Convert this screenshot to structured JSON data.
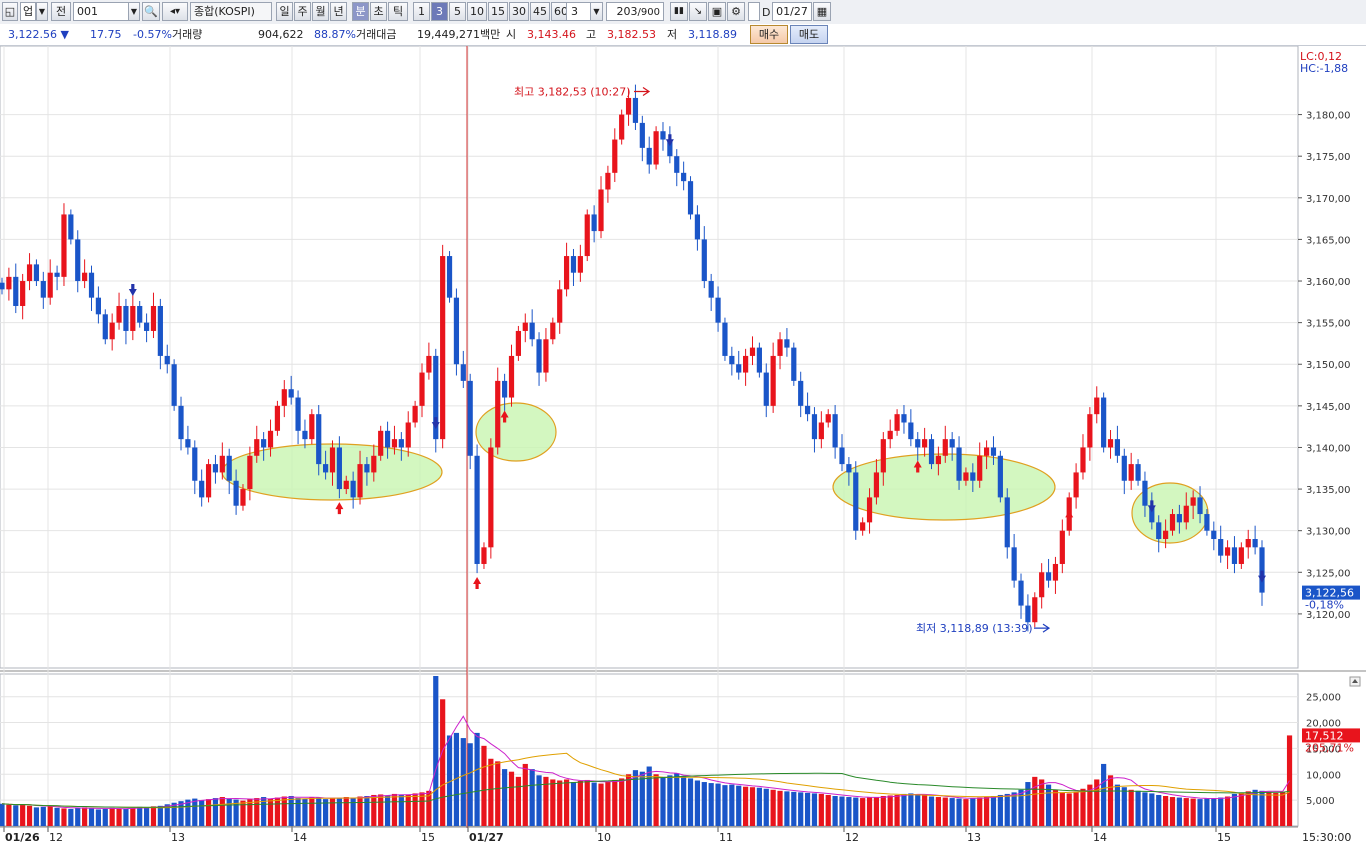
{
  "toolbar": {
    "market_label": "업",
    "prev_label": "전",
    "code_value": "001",
    "index_name": "종합(KOSPI)",
    "period_buttons": [
      "일",
      "주",
      "월",
      "년",
      "분",
      "초",
      "틱"
    ],
    "interval_buttons": [
      "1",
      "3",
      "5",
      "10",
      "15",
      "30",
      "45",
      "60"
    ],
    "interval_input": "3",
    "count_value": "203",
    "count_total": "/900",
    "date_value": "01/27",
    "d_label": "D"
  },
  "quote": {
    "price": "3,122.56",
    "change": "17.75",
    "change_pct": "-0.57%",
    "volume_label": "거래량",
    "volume": "904,622",
    "volume_ratio": "88.87%",
    "amount_label": "거래대금",
    "amount": "19,449,271",
    "amount_unit": "백만",
    "open_label": "시",
    "open": "3,143.46",
    "high_label": "고",
    "high": "3,182.53",
    "low_label": "저",
    "low": "3,118.89",
    "buy_label": "매수",
    "sell_label": "매도"
  },
  "chart_data": {
    "type": "candlestick",
    "y_ticks": [
      "3,180,00",
      "3,175,00",
      "3,170,00",
      "3,165,00",
      "3,160,00",
      "3,155,00",
      "3,150,00",
      "3,145,00",
      "3,140,00",
      "3,135,00",
      "3,130,00",
      "3,125,00",
      "3,120,00"
    ],
    "y_values": [
      3180,
      3175,
      3170,
      3165,
      3160,
      3155,
      3150,
      3145,
      3140,
      3135,
      3130,
      3125,
      3120
    ],
    "ylim": [
      3113.5,
      3188
    ],
    "price_label": "3,122,56",
    "price_label_value": 3122.56,
    "price_change_label": "-0,18%",
    "lc_label": "LC:0,12",
    "hc_label": "HC:-1,88",
    "high_annotation": "최고 3,182,53 (10:27)",
    "high_value": 3182.53,
    "low_annotation": "최저 3,118,89 (13:39)",
    "low_value": 3118.89,
    "x_labels": [
      "01/26",
      "12",
      "13",
      "14",
      "15",
      "01/27",
      "10",
      "11",
      "12",
      "13",
      "14",
      "15"
    ],
    "time_label": "15:30:00",
    "volume_ticks": [
      "25,000",
      "20,000",
      "15,000",
      "10,000",
      "5,000"
    ],
    "volume_tick_values": [
      25000,
      20000,
      15000,
      10000,
      5000
    ],
    "volume_ylim": [
      0,
      29000
    ],
    "volume_label": "17,512",
    "volume_label_value": 17512,
    "volume_ratio_label": "205,71%",
    "colors": {
      "up": "#e8141c",
      "down": "#1a55c8",
      "ellipse_fill": "#c8f5b0",
      "ellipse_stroke": "#e0a020"
    },
    "price_path": [
      3159,
      3160.5,
      3157,
      3160,
      3162,
      3160,
      3158,
      3161,
      3160.5,
      3168,
      3165,
      3160,
      3161,
      3158,
      3156,
      3153,
      3155,
      3157,
      3154,
      3157,
      3155,
      3154,
      3157,
      3151,
      3150,
      3145,
      3141,
      3140,
      3136,
      3134,
      3138,
      3137,
      3139,
      3136,
      3133,
      3135,
      3139,
      3141,
      3140,
      3142,
      3145,
      3147,
      3146,
      3142,
      3141,
      3144,
      3138,
      3137,
      3140,
      3135,
      3136,
      3134,
      3138,
      3137,
      3139,
      3142,
      3140,
      3141,
      3140,
      3143,
      3145,
      3149,
      3151,
      3141,
      3163,
      3158,
      3150,
      3148,
      3139,
      3126,
      3128,
      3140,
      3148,
      3146,
      3151,
      3154,
      3155,
      3153,
      3149,
      3153,
      3155,
      3159,
      3163,
      3161,
      3163,
      3168,
      3166,
      3171,
      3173,
      3177,
      3180,
      3182,
      3179,
      3176,
      3174,
      3178,
      3177,
      3175,
      3173,
      3172,
      3168,
      3165,
      3160,
      3158,
      3155,
      3151,
      3150,
      3149,
      3151,
      3152,
      3149,
      3145,
      3151,
      3153,
      3152,
      3148,
      3145,
      3144,
      3141,
      3143,
      3144,
      3140,
      3138,
      3137,
      3130,
      3131,
      3134,
      3137,
      3141,
      3142,
      3144,
      3143,
      3141,
      3140,
      3141,
      3138,
      3139,
      3141,
      3140,
      3136,
      3137,
      3136,
      3139,
      3140,
      3139,
      3134,
      3128,
      3124,
      3121,
      3119,
      3122,
      3125,
      3124,
      3126,
      3130,
      3134,
      3137,
      3140,
      3144,
      3146,
      3140,
      3141,
      3139,
      3136,
      3138,
      3136,
      3133,
      3131,
      3129,
      3130,
      3132,
      3131,
      3133,
      3134,
      3132,
      3130,
      3129,
      3127,
      3128,
      3126,
      3128,
      3129,
      3128,
      3122.56
    ],
    "volumes": [
      4300,
      4100,
      4000,
      4200,
      3900,
      3600,
      3700,
      3800,
      3500,
      3400,
      3300,
      3500,
      3600,
      3400,
      3200,
      3300,
      3500,
      3400,
      3300,
      3500,
      3700,
      3600,
      3800,
      3900,
      4200,
      4500,
      4800,
      5100,
      5300,
      5000,
      5200,
      5400,
      5600,
      5300,
      5100,
      4900,
      5200,
      5400,
      5600,
      5300,
      5500,
      5700,
      5800,
      5400,
      5300,
      5600,
      5500,
      5200,
      5400,
      5300,
      5600,
      5500,
      5700,
      5800,
      6000,
      6100,
      5900,
      6200,
      6000,
      6100,
      6300,
      6500,
      6800,
      29000,
      24500,
      17500,
      18000,
      17000,
      16000,
      18000,
      15500,
      13000,
      12500,
      11000,
      10500,
      9500,
      12000,
      11000,
      9800,
      9500,
      9000,
      8800,
      9000,
      8500,
      8700,
      8900,
      8400,
      8200,
      8600,
      8900,
      9200,
      10000,
      10800,
      10500,
      11500,
      10000,
      9500,
      9800,
      10200,
      9700,
      9200,
      8800,
      8500,
      8300,
      8200,
      7900,
      8000,
      7800,
      7600,
      7500,
      7400,
      7200,
      7000,
      6800,
      6700,
      6600,
      6500,
      6400,
      6300,
      6200,
      6000,
      5800,
      5700,
      5600,
      5500,
      5400,
      5500,
      5600,
      5800,
      5900,
      6000,
      6200,
      6300,
      6100,
      5900,
      5700,
      5600,
      5500,
      5400,
      5300,
      5200,
      5400,
      5500,
      5700,
      5800,
      6000,
      6200,
      6500,
      7000,
      8500,
      9500,
      9000,
      8000,
      7000,
      6500,
      6300,
      6600,
      7200,
      8000,
      9000,
      12000,
      9800,
      8000,
      7500,
      7000,
      6800,
      6500,
      6300,
      6000,
      5800,
      5600,
      5500,
      5400,
      5300,
      5200,
      5300,
      5400,
      5500,
      5700,
      6200,
      6400,
      6700,
      7000,
      6800,
      6600,
      6400,
      6600,
      17512
    ]
  }
}
